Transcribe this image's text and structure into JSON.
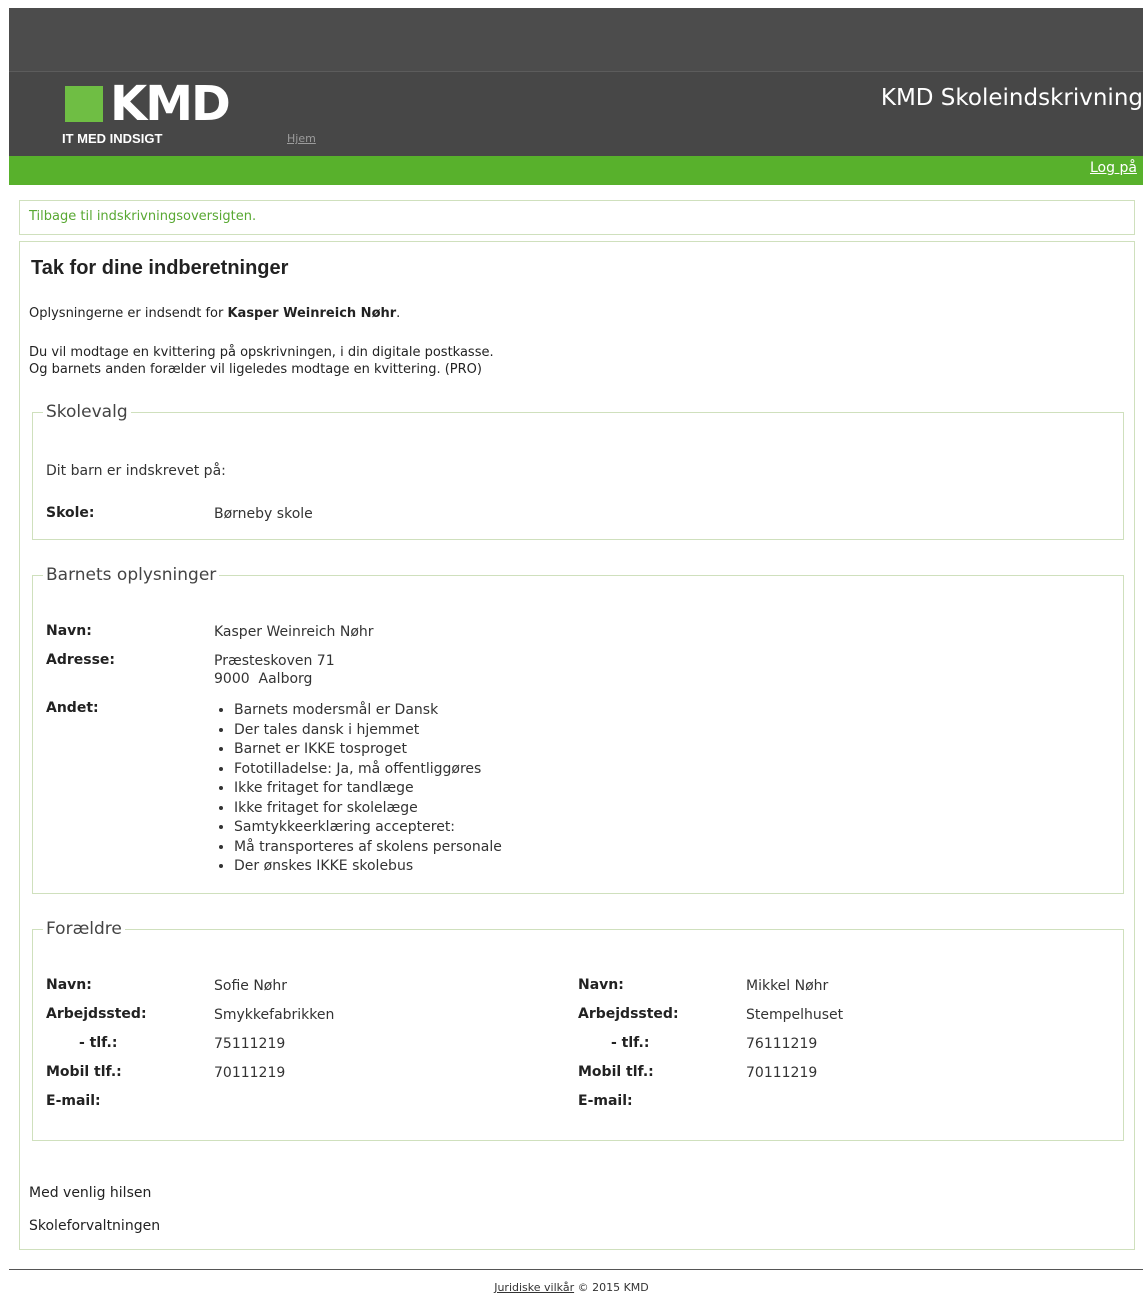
{
  "header": {
    "logo_text": "KMD",
    "tagline": "IT MED INDSIGT",
    "home_link": "Hjem",
    "app_title": "KMD Skoleindskrivning",
    "login_link": "Log på",
    "brand_green": "#58b12c",
    "header_dark": "#474747"
  },
  "back_link": "Tilbage til indskrivningsoversigten.",
  "main": {
    "title": "Tak for dine indberetninger",
    "submitted_prefix": "Oplysningerne er indsendt for ",
    "submitted_name": "Kasper Weinreich Nøhr",
    "submitted_suffix": ".",
    "receipt_line1": "Du vil modtage en kvittering på opskrivningen, i din digitale postkasse.",
    "receipt_line2": "Og barnets anden forælder vil ligeledes modtage en kvittering. (PRO)"
  },
  "skolevalg": {
    "legend": "Skolevalg",
    "intro": "Dit barn er indskrevet på:",
    "school_label": "Skole:",
    "school_value": "Børneby skole"
  },
  "barnet": {
    "legend": "Barnets oplysninger",
    "name_label": "Navn:",
    "name_value": "Kasper Weinreich Nøhr",
    "address_label": "Adresse:",
    "address_line1": "Præsteskoven 71",
    "address_line2": "9000  Aalborg",
    "other_label": "Andet:",
    "other_items": [
      "Barnets modersmål er Dansk",
      "Der tales dansk i hjemmet",
      "Barnet er IKKE tosproget",
      "Fototilladelse: Ja, må offentliggøres",
      "Ikke fritaget for tandlæge",
      "Ikke fritaget for skolelæge",
      "Samtykkeerklæring accepteret:",
      "Må transporteres af skolens personale",
      "Der ønskes IKKE skolebus"
    ]
  },
  "foraeldre": {
    "legend": "Forældre",
    "labels": {
      "name": "Navn:",
      "workplace": "Arbejdssted:",
      "phone": "- tlf.:",
      "mobile": "Mobil tlf.:",
      "email": "E-mail:"
    },
    "parents": [
      {
        "name": "Sofie Nøhr",
        "workplace": "Smykkefabrikken",
        "phone": "75111219",
        "mobile": "70111219",
        "email": ""
      },
      {
        "name": "Mikkel Nøhr",
        "workplace": "Stempelhuset",
        "phone": "76111219",
        "mobile": "70111219",
        "email": ""
      }
    ]
  },
  "closing": {
    "greeting": "Med venlig hilsen",
    "sender": "Skoleforvaltningen"
  },
  "footer": {
    "legal_link": "Juridiske vilkår",
    "copyright": " © 2015 KMD"
  }
}
